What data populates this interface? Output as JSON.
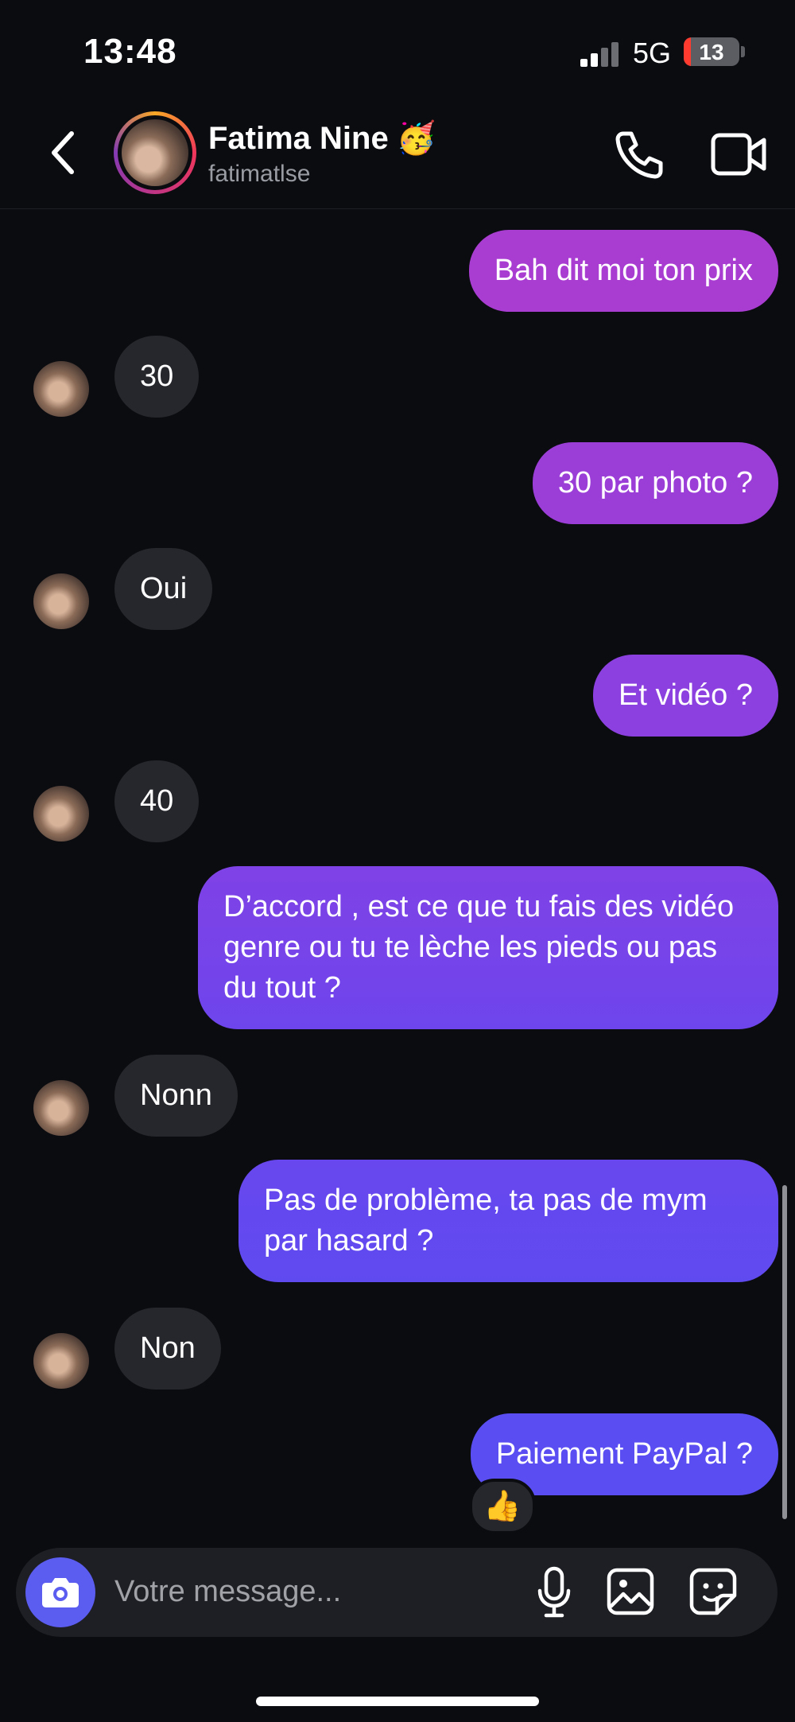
{
  "status": {
    "time": "13:48",
    "network": "5G",
    "battery": "13",
    "battery_pct": 13
  },
  "header": {
    "name": "Fatima Nine",
    "name_emoji": "🥳",
    "username": "fatimatlse"
  },
  "messages": [
    {
      "side": "out",
      "text": "Bah dit moi ton prix"
    },
    {
      "side": "in",
      "text": "30"
    },
    {
      "side": "out",
      "text": "30 par photo ?"
    },
    {
      "side": "in",
      "text": "Oui"
    },
    {
      "side": "out",
      "text": "Et vidéo ?"
    },
    {
      "side": "in",
      "text": "40"
    },
    {
      "side": "out",
      "text": "D’accord , est ce que tu fais des vidéo genre ou tu te lèche les pieds ou pas du tout ?"
    },
    {
      "side": "in",
      "text": "Nonn"
    },
    {
      "side": "out",
      "text": "Pas de problème, ta pas de mym par hasard ?"
    },
    {
      "side": "in",
      "text": "Non"
    },
    {
      "side": "out",
      "text": "Paiement PayPal ?",
      "reaction": "👍"
    }
  ],
  "composer": {
    "placeholder": "Votre message..."
  },
  "colors": {
    "out_top": "#b03ed0",
    "out_bottom": "#5e52f0",
    "in": "#26272c",
    "camera": "#5b5cf0"
  }
}
